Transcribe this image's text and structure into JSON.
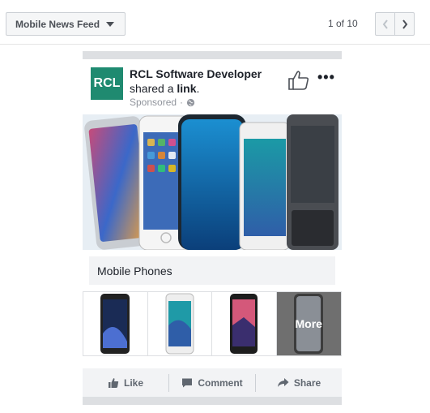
{
  "toolbar": {
    "placement_label": "Mobile News Feed",
    "pager_text": "1 of 10"
  },
  "post": {
    "page_name": "RCL Software Developer",
    "avatar_text": "RCL",
    "shared_prefix": "shared a",
    "shared_link_word": "link",
    "shared_suffix": ".",
    "sponsored_label": "Sponsored",
    "sponsored_separator": "·",
    "link_title": "Mobile Phones",
    "carousel_more_label": "More"
  },
  "actions": {
    "like": "Like",
    "comment": "Comment",
    "share": "Share"
  },
  "colors": {
    "avatar_bg": "#1f8a70",
    "action_text": "#606770",
    "frame_gray": "#dddfe2"
  },
  "icons": [
    "chevron-down-icon",
    "chevron-left-icon",
    "chevron-right-icon",
    "thumbs-up-icon",
    "globe-icon",
    "ellipsis-icon",
    "comment-icon",
    "share-arrow-icon"
  ]
}
